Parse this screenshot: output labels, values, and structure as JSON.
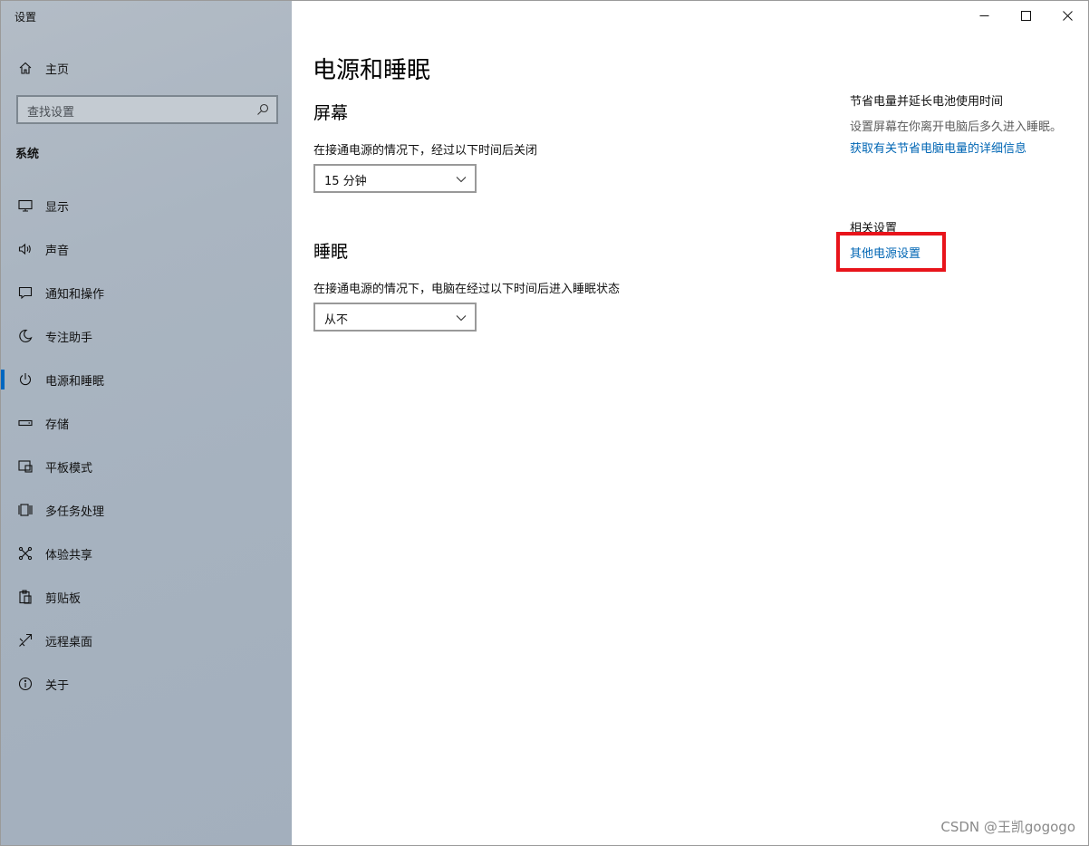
{
  "window": {
    "title": "设置"
  },
  "sidebar": {
    "home_label": "主页",
    "search_placeholder": "查找设置",
    "section_label": "系统",
    "items": [
      {
        "label": "显示",
        "icon": "display-icon"
      },
      {
        "label": "声音",
        "icon": "speaker-icon"
      },
      {
        "label": "通知和操作",
        "icon": "notification-icon"
      },
      {
        "label": "专注助手",
        "icon": "moon-icon"
      },
      {
        "label": "电源和睡眠",
        "icon": "power-icon",
        "active": true
      },
      {
        "label": "存储",
        "icon": "storage-icon"
      },
      {
        "label": "平板模式",
        "icon": "tablet-icon"
      },
      {
        "label": "多任务处理",
        "icon": "multitask-icon"
      },
      {
        "label": "体验共享",
        "icon": "share-icon"
      },
      {
        "label": "剪贴板",
        "icon": "clipboard-icon"
      },
      {
        "label": "远程桌面",
        "icon": "remote-icon"
      },
      {
        "label": "关于",
        "icon": "info-icon"
      }
    ],
    "active_color": "#0067c0"
  },
  "main": {
    "page_title": "电源和睡眠",
    "screen": {
      "title": "屏幕",
      "desc": "在接通电源的情况下，经过以下时间后关闭",
      "value": "15 分钟"
    },
    "sleep": {
      "title": "睡眠",
      "desc": "在接通电源的情况下，电脑在经过以下时间后进入睡眠状态",
      "value": "从不"
    }
  },
  "right": {
    "heading": "节省电量并延长电池使用时间",
    "text": "设置屏幕在你离开电脑后多久进入睡眠。",
    "link": "获取有关节省电脑电量的详细信息",
    "related_heading": "相关设置",
    "related_link": "其他电源设置",
    "link_color": "#0066b4",
    "highlight_color": "#e8141b"
  },
  "watermark": "CSDN @王凯gogogo"
}
